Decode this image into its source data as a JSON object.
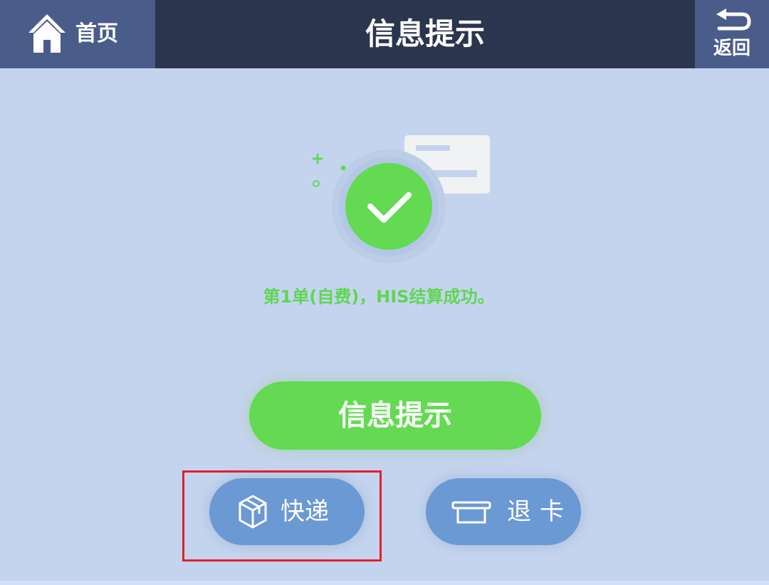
{
  "header": {
    "home_label": "首页",
    "title": "信息提示",
    "back_label": "返回"
  },
  "status": {
    "message": "第1单(自费)，HIS结算成功。"
  },
  "actions": {
    "primary_label": "信息提示",
    "express_label": "快递",
    "return_card_label": "退卡"
  },
  "icons": {
    "home": "home-icon",
    "back": "back-arrow-icon",
    "success": "success-check-icon",
    "express": "package-box-icon",
    "return_card": "card-slot-icon"
  },
  "colors": {
    "header_bg": "#2b354d",
    "header_button_bg": "#4a5c8a",
    "page_bg": "#c5d4ee",
    "success_green": "#63da51",
    "secondary_button": "#6b99d3",
    "highlight": "#e0202a"
  }
}
